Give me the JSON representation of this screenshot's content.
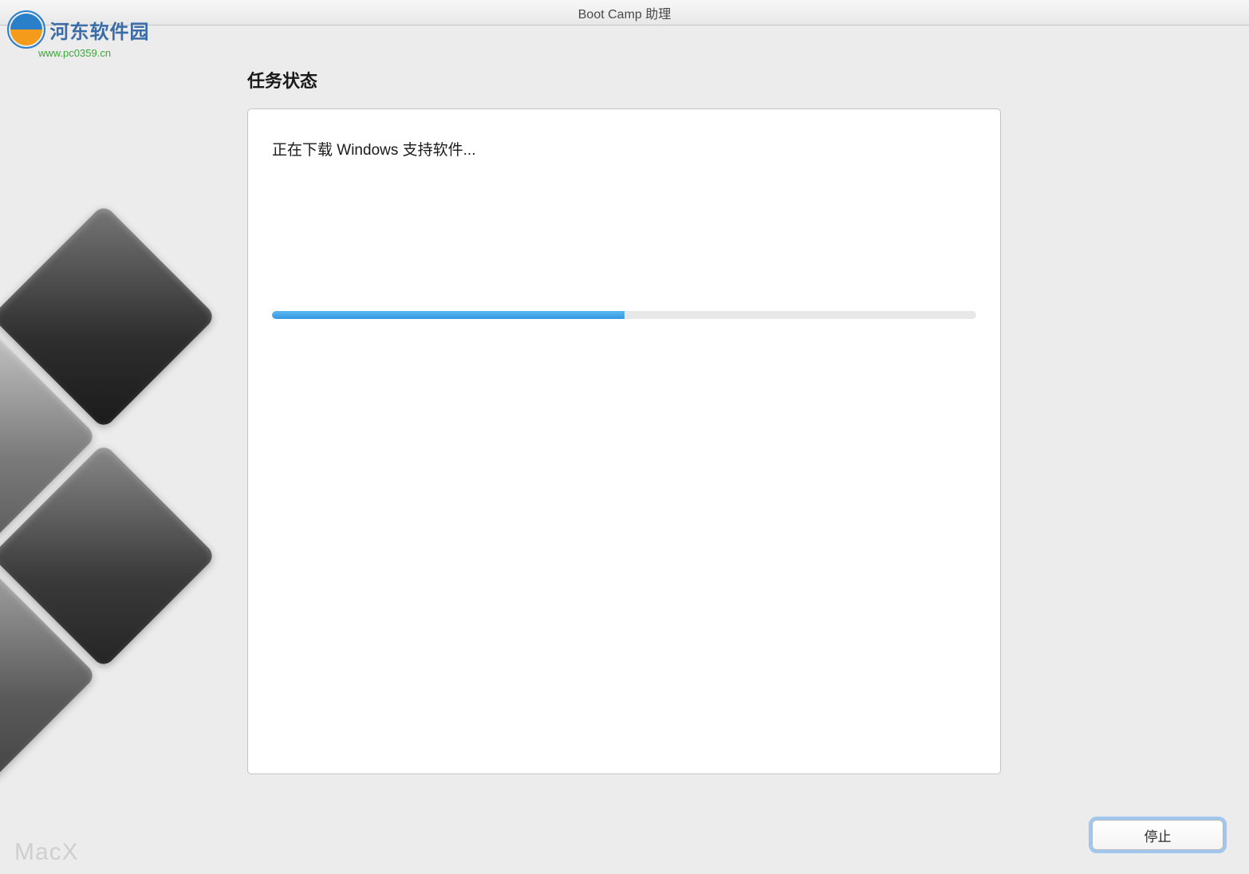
{
  "window": {
    "title": "Boot Camp 助理"
  },
  "watermark": {
    "site_name": "河东软件园",
    "site_url": "www.pc0359.cn",
    "bottom_left": "MacX"
  },
  "main": {
    "section_title": "任务状态",
    "status_message": "正在下载 Windows 支持软件...",
    "progress_percent": 50
  },
  "buttons": {
    "stop": "停止"
  }
}
